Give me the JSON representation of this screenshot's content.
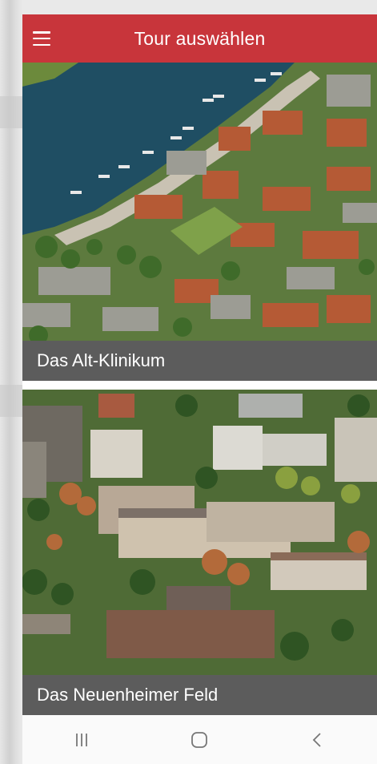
{
  "app_bar": {
    "title": "Tour auswählen",
    "menu_icon": "hamburger-menu-icon",
    "color": "#c8353b"
  },
  "tours": [
    {
      "name": "Das Alt-Klinikum"
    },
    {
      "name": "Das Neuenheimer Feld"
    }
  ],
  "caption_color": "#5c5c5c",
  "system_nav": {
    "buttons": [
      "recent-apps-icon",
      "home-icon",
      "back-icon"
    ]
  }
}
